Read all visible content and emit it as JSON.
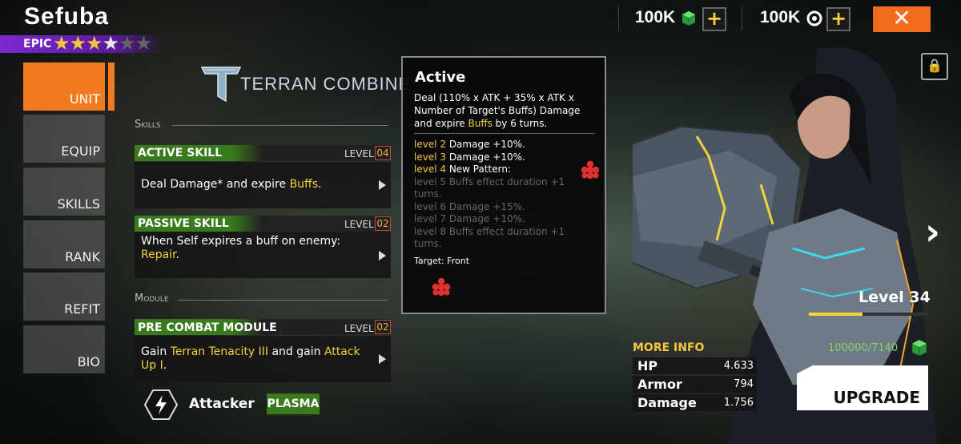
{
  "hero": {
    "name": "Sefuba",
    "rarity": "EPIC",
    "stars_total": 6,
    "stars_filled": 3,
    "stars_half": 1
  },
  "resources": [
    {
      "value": "100K",
      "icon": "green-cube-icon"
    },
    {
      "value": "100K",
      "icon": "credit-coin-icon"
    }
  ],
  "close_symbol": "✕",
  "tabs": [
    "UNIT",
    "EQUIP",
    "SKILLS",
    "RANK",
    "REFIT",
    "BIO"
  ],
  "faction": {
    "name": "TERRAN COMBINE"
  },
  "sections": {
    "skills": "Skills",
    "module": "Module"
  },
  "skills": [
    {
      "title": "ACTIVE SKILL",
      "level_label": "LEVEL",
      "level": "04",
      "desc_parts": [
        "Deal Damage* and expire ",
        "Buffs",
        "."
      ]
    },
    {
      "title": "PASSIVE SKILL",
      "level_label": "LEVEL",
      "level": "02",
      "desc_parts": [
        "When Self expires a buff on enemy: ",
        "Repair",
        "."
      ]
    }
  ],
  "module": {
    "title": "PRE COMBAT MODULE",
    "level_label": "LEVEL",
    "level": "02",
    "desc_parts": [
      "Gain ",
      "Terran Tenacity III",
      " and gain ",
      "Attack Up I",
      "."
    ]
  },
  "role": {
    "label": "Attacker",
    "damage_type": "PLASMA"
  },
  "popup": {
    "title": "Active",
    "desc_parts": [
      "Deal (110% x ATK + 35% x ATK x Number of Target's Buffs) Damage and expire ",
      "Buffs",
      " by 6 turns."
    ],
    "levels": [
      {
        "lv": "level 2",
        "text": "Damage +10%.",
        "unlocked": true
      },
      {
        "lv": "level 3",
        "text": "Damage +10%.",
        "unlocked": true
      },
      {
        "lv": "level 4",
        "text": "New Pattern:",
        "unlocked": true
      },
      {
        "lv": "level 5",
        "text": "Buffs effect duration +1 turns.",
        "unlocked": false
      },
      {
        "lv": "level 6",
        "text": "Damage +15%.",
        "unlocked": false
      },
      {
        "lv": "level 7",
        "text": "Damage +10%.",
        "unlocked": false
      },
      {
        "lv": "level 8",
        "text": "Buffs effect duration +1 turns.",
        "unlocked": false
      }
    ],
    "target": "Target: Front"
  },
  "level_display": {
    "label": "Level 34",
    "xp_text": "100000/7140",
    "xp_fraction": 0.45
  },
  "more_info": {
    "label": "MORE INFO",
    "stats": [
      {
        "name": "HP",
        "value": "4.633"
      },
      {
        "name": "Armor",
        "value": "794"
      },
      {
        "name": "Damage",
        "value": "1.756"
      }
    ]
  },
  "upgrade_label": "UPGRADE",
  "next_symbol": "›",
  "colors": {
    "accent_orange": "#f27a20",
    "skill_green": "#3a7a1e",
    "highlight_yellow": "#f5d23a",
    "xp_green": "#7ed56a",
    "rarity_purple": "#7a2ad0"
  }
}
